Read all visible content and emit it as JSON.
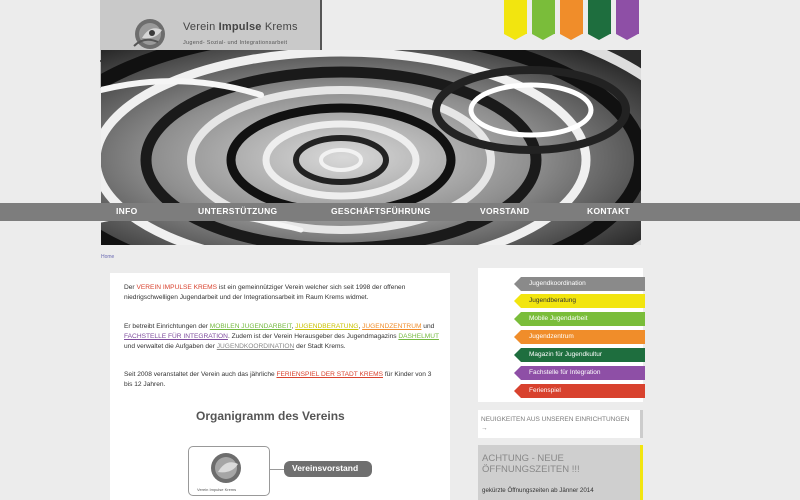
{
  "header": {
    "logo_title_prefix": "Verein ",
    "logo_title_bold": "Impulse",
    "logo_title_suffix": " Krems",
    "logo_subtitle": "Jugend- Sozial- und Integrationsarbeit",
    "ribbon_colors": [
      "#f2e50f",
      "#7abd3a",
      "#f08d2a",
      "#1e6e3e",
      "#8e4fa6"
    ]
  },
  "nav": {
    "items": [
      "INFO",
      "UNTERSTÜTZUNG",
      "GESCHÄFTSFÜHRUNG",
      "VORSTAND",
      "KONTAKT"
    ]
  },
  "breadcrumb": "Home",
  "main": {
    "p1_a": "Der ",
    "p1_link": "VEREIN IMPULSE KREMS",
    "p1_b": " ist ein gemeinnütziger Verein welcher sich seit 1998 der offenen niedrigschwelligen Jugendarbeit und der Integrationsarbeit im Raum Krems widmet.",
    "p2_a": "Er betreibt Einrichtungen der ",
    "p2_l1": "MOBILEN JUGENDARBEIT",
    "p2_b": ", ",
    "p2_l2": "JUGENDBERATUNG",
    "p2_c": ", ",
    "p2_l3": "JUGENDZENTRUM",
    "p2_d": " und ",
    "p2_l4": "FACHSTELLE FÜR INTEGRATION",
    "p2_e": ". Zudem ist der Verein Herausgeber des Jugendmagazins ",
    "p2_l5": "DASHELMUT",
    "p2_f": " und verwaltet die Aufgaben der ",
    "p2_l6": "JUGENDKOORDINATION",
    "p2_g": " der Stadt Krems.",
    "p3_a": "Seit 2008 veranstaltet der Verein auch das jährliche ",
    "p3_link": "FERIENSPIEL DER STADT KREMS",
    "p3_b": " für Kinder von 3 bis 12 Jahren.",
    "org_title": "Organigramm des Vereins",
    "org_box_text": "Verein Impulse Krems",
    "org_pill": "Vereinsvorstand"
  },
  "sidebar": {
    "items": [
      {
        "label": "Jugendkoordination",
        "bg": "#8a8a8a",
        "fg": "#ffffff"
      },
      {
        "label": "Jugendberatung",
        "bg": "#f2e50f",
        "fg": "#333333"
      },
      {
        "label": "Mobile Jugendarbeit",
        "bg": "#7abd3a",
        "fg": "#ffffff"
      },
      {
        "label": "Jugendzentrum",
        "bg": "#f08d2a",
        "fg": "#ffffff"
      },
      {
        "label": "Magazin für Jugendkultur",
        "bg": "#1e6e3e",
        "fg": "#ffffff"
      },
      {
        "label": "Fachstelle für Integration",
        "bg": "#8e4fa6",
        "fg": "#ffffff"
      },
      {
        "label": "Ferienspiel",
        "bg": "#d8422e",
        "fg": "#ffffff"
      }
    ],
    "news_label": "NEUIGKEITEN AUS UNSEREN EINRICHTUNGEN →",
    "notice_title": "ACHTUNG - NEUE ÖFFNUNGSZEITEN !!!",
    "notice_text": "gekürzte Öffnungszeiten ab Jänner 2014"
  }
}
